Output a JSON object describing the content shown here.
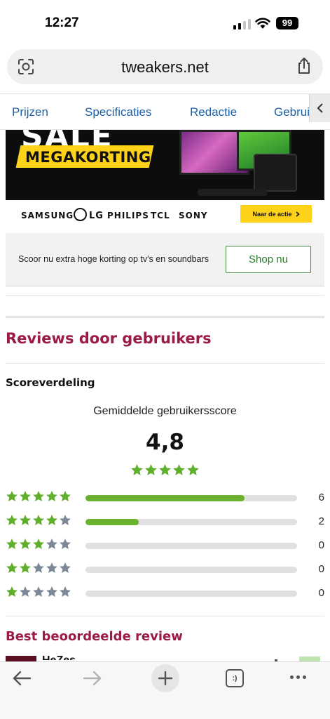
{
  "status_bar": {
    "time": "12:27",
    "battery": "99"
  },
  "browser": {
    "url": "tweakers.net"
  },
  "tabs": [
    {
      "label": "Prijzen"
    },
    {
      "label": "Specificaties"
    },
    {
      "label": "Redactie"
    },
    {
      "label": "Gebrui"
    }
  ],
  "banner": {
    "headline": "SALE",
    "badge": "MEGAKORTING",
    "brands": [
      "SAMSUNG",
      "LG",
      "PHILIPS",
      "TCL",
      "SONY"
    ],
    "cta": "Naar de actie"
  },
  "promo": {
    "text": "Scoor nu extra hoge korting op tv's en soundbars",
    "button": "Shop nu"
  },
  "reviews": {
    "title": "Reviews door gebruikers",
    "distribution_title": "Scoreverdeling",
    "average_label": "Gemiddelde gebruikersscore",
    "average_value": "4,8",
    "average_stars": 5,
    "rows": [
      {
        "stars": 5,
        "count": "6",
        "fraction": 0.75
      },
      {
        "stars": 4,
        "count": "2",
        "fraction": 0.25
      },
      {
        "stars": 3,
        "count": "0",
        "fraction": 0
      },
      {
        "stars": 2,
        "count": "0",
        "fraction": 0
      },
      {
        "stars": 1,
        "count": "0",
        "fraction": 0
      }
    ]
  },
  "best_review": {
    "title": "Best beoordeelde review",
    "author": "HeZes"
  },
  "colors": {
    "accent": "#9b1b45",
    "link": "#1e61a8",
    "star_filled": "#5fae2c",
    "star_empty": "#7c8898",
    "bar": "#6ab22e",
    "banner_yellow": "#ffd21a"
  },
  "icons": {
    "lens": "camera-lens-icon",
    "share": "share-icon",
    "tab_scroll": "chevron-left-icon",
    "back": "arrow-left-icon",
    "forward": "arrow-right-icon",
    "new_tab": "plus-icon",
    "tabs": "tabs-icon",
    "more": "ellipsis-icon"
  }
}
